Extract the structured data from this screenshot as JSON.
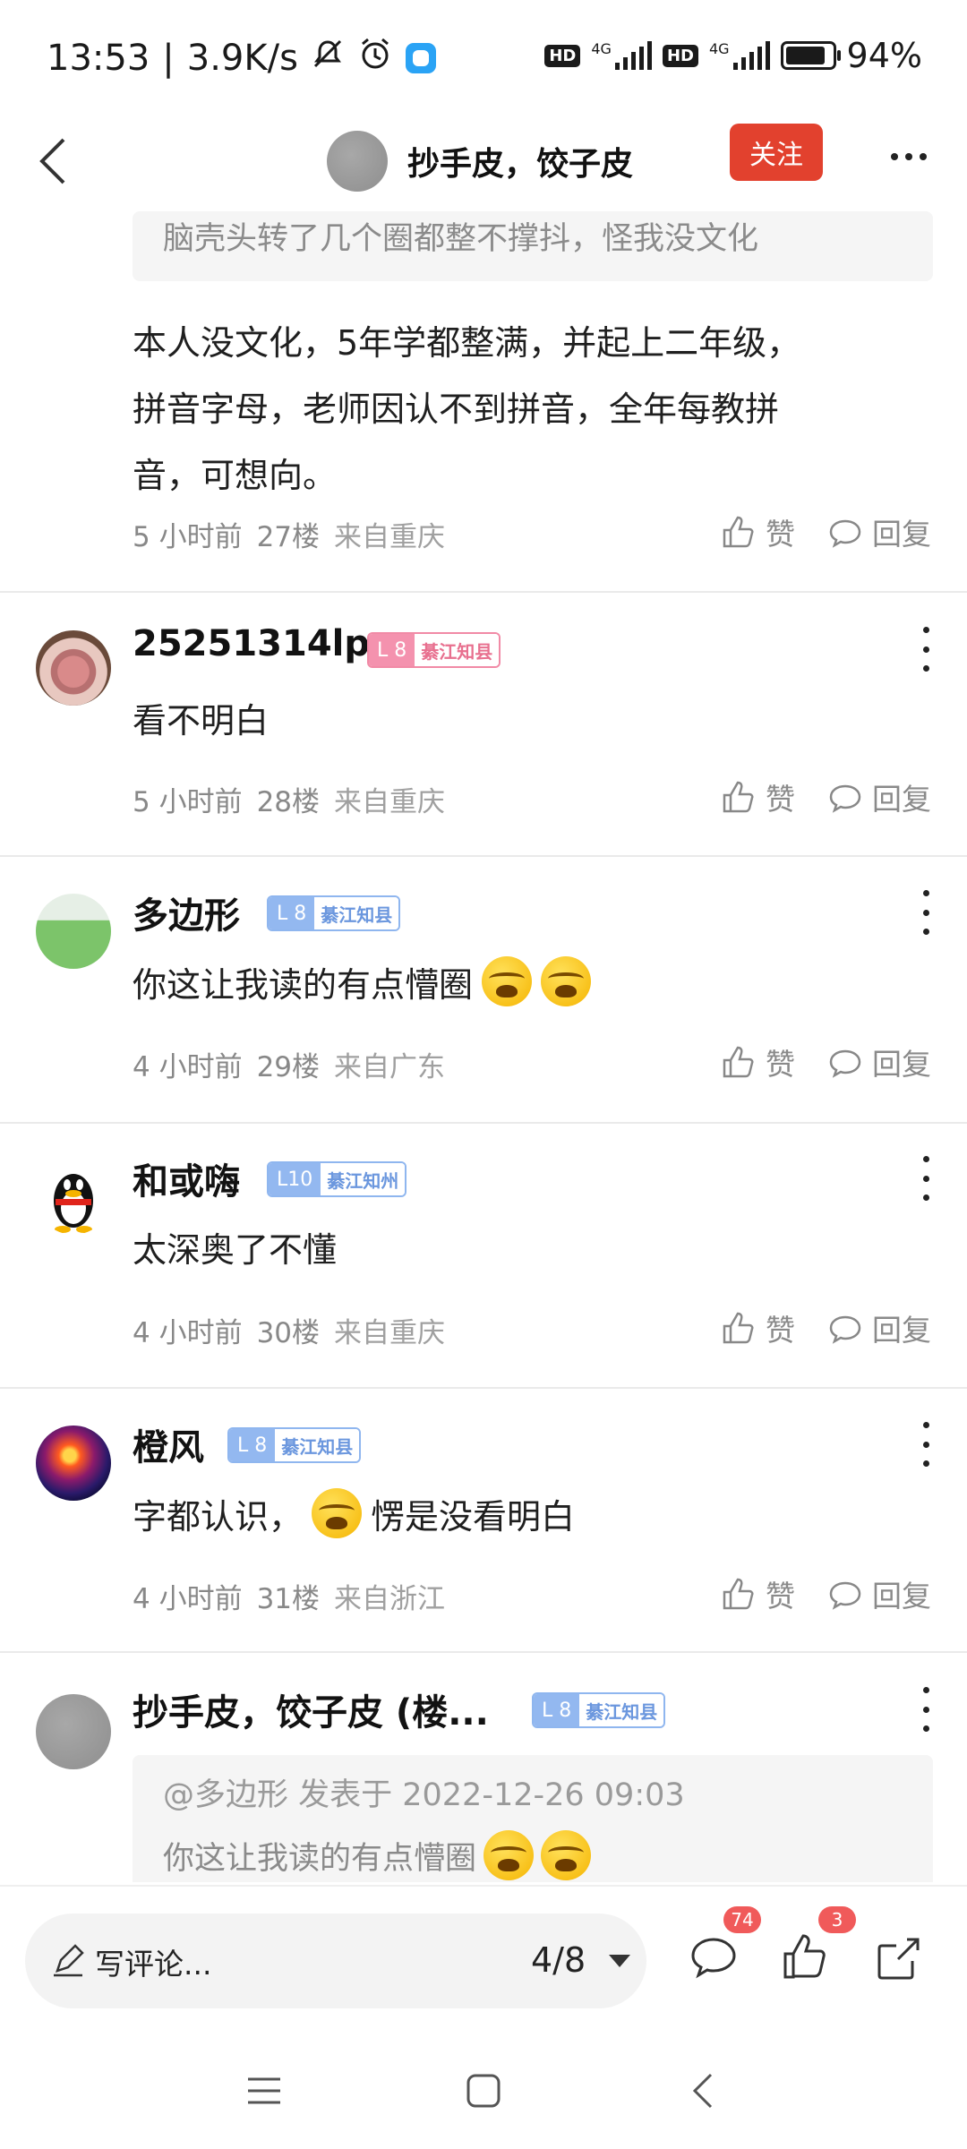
{
  "status_bar": {
    "time": "13:53",
    "net_speed": "3.9K/s",
    "network1": "4G",
    "network2": "4G",
    "hd": "HD",
    "battery": "94%",
    "battery_level": 94
  },
  "topnav": {
    "title": "抄手皮，饺子皮",
    "follow_label": "关注"
  },
  "top_comment": {
    "quote": "脑壳头转了几个圈都整不撑抖，怪我没文化",
    "lines": [
      "本人没文化，5年学都整满，并起上二年级，",
      "拼音字母，老师因认不到拼音，全年每教拼",
      "音，可想向。"
    ],
    "time": "5 小时前",
    "floor": "27楼",
    "location": "来自重庆"
  },
  "actions": {
    "like": "赞",
    "reply": "回复"
  },
  "comments": [
    {
      "name": "25251314lp",
      "level": "L 8",
      "title": "綦江知县",
      "text": "看不明白",
      "time": "5 小时前",
      "floor": "28楼",
      "location": "来自重庆"
    },
    {
      "name": "多边形",
      "level": "L 8",
      "title": "綦江知县",
      "text": "你这让我读的有点懵圈",
      "time": "4 小时前",
      "floor": "29楼",
      "location": "来自广东"
    },
    {
      "name": "和或嗨",
      "level": "L10",
      "title": "綦江知州",
      "text": "太深奥了不懂",
      "time": "4 小时前",
      "floor": "30楼",
      "location": "来自重庆"
    },
    {
      "name": "橙风",
      "level": "L 8",
      "title": "綦江知县",
      "text_a": "字都认识，",
      "text_b": "愣是没看明白",
      "time": "4 小时前",
      "floor": "31楼",
      "location": "来自浙江"
    },
    {
      "name": "抄手皮，饺子皮 (楼...",
      "level": "L 8",
      "title": "綦江知县",
      "quote_head": "@多边形 发表于 2022-12-26 09:03",
      "quote_text": "你这让我读的有点懵圈"
    }
  ],
  "bottom_bar": {
    "placeholder": "写评论...",
    "page": "4/8",
    "comment_count": "74",
    "like_count": "3"
  }
}
